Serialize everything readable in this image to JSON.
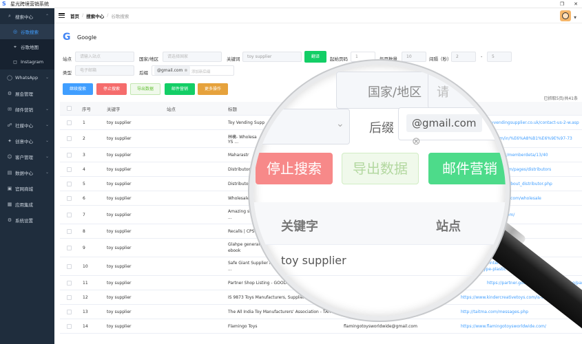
{
  "app": {
    "title": "星光跨境营销系统",
    "logo_glyph": "S"
  },
  "window": {
    "restore_glyph": "❐",
    "close_glyph": "✕"
  },
  "sidebar": {
    "items": [
      {
        "label": "搜索中心",
        "icon": "search-icon",
        "glyph": "⌕",
        "arrow": "⌃"
      },
      {
        "label": "谷歌搜索",
        "icon": "google-search-icon",
        "glyph": "◎",
        "sub": true,
        "active": true
      },
      {
        "label": "谷歌地图",
        "icon": "map-pin-icon",
        "glyph": "⌖",
        "sub": true
      },
      {
        "label": "Instagram",
        "icon": "instagram-icon",
        "glyph": "◻",
        "sub": true
      },
      {
        "label": "WhatsApp",
        "icon": "whatsapp-icon",
        "glyph": "◯",
        "arrow": "⌄"
      },
      {
        "label": "展会管理",
        "icon": "expo-icon",
        "glyph": "⚙"
      },
      {
        "label": "邮件营销",
        "icon": "mail-icon",
        "glyph": "✉",
        "arrow": "⌄"
      },
      {
        "label": "社媒中心",
        "icon": "social-icon",
        "glyph": "☍",
        "arrow": "⌄"
      },
      {
        "label": "创意中心",
        "icon": "idea-icon",
        "glyph": "✦",
        "arrow": "⌄"
      },
      {
        "label": "客户管理",
        "icon": "customer-icon",
        "glyph": "☺",
        "arrow": "⌄"
      },
      {
        "label": "数据中心",
        "icon": "data-icon",
        "glyph": "▤",
        "arrow": "⌄"
      },
      {
        "label": "官网商城",
        "icon": "store-icon",
        "glyph": "▣"
      },
      {
        "label": "应用集成",
        "icon": "apps-icon",
        "glyph": "▦"
      },
      {
        "label": "系统设置",
        "icon": "settings-icon",
        "glyph": "⚙"
      }
    ]
  },
  "breadcrumb": {
    "home": "首页",
    "sep": "/",
    "section": "搜索中心",
    "current": "谷歌搜索"
  },
  "page": {
    "engine_name": "Google",
    "stats": "已抓取5页/共41条"
  },
  "filters": {
    "site_label": "站点",
    "site_placeholder": "请输入站点",
    "country_label": "国家/地区",
    "country_placeholder": "请选择国家",
    "keyword_label": "关键词",
    "keyword_value": "toy supplier",
    "translate_label": "翻译",
    "start_page_label": "起始页码",
    "start_page_value": "1",
    "per_page_label": "每页数量",
    "per_page_value": "10",
    "interval_label": "间隔（秒）",
    "interval_from": "2",
    "interval_dash": "-",
    "interval_to": "5",
    "type_label": "类型",
    "type_value": "电子邮箱",
    "suffix_label": "后缀",
    "suffix_tag": "@gmail.com",
    "suffix_placeholder": "添加新后缀"
  },
  "actions": {
    "continue": "继续搜索",
    "stop": "停止搜索",
    "export": "导出数据",
    "email": "邮件营销",
    "more": "更多操作"
  },
  "table": {
    "headers": [
      "序号",
      "关键字",
      "站点",
      "标题"
    ],
    "rows": [
      {
        "no": "1",
        "kw": "toy supplier",
        "title": "Toy Vending Supp",
        "email": "",
        "url": "toyvendingsupplier.co.uk/contact-us-2-w.asp"
      },
      {
        "no": "2",
        "kw": "toy supplier",
        "title": "林檎- Wholesa",
        "title2": "YS ...",
        "email": "",
        "url": "din.com/in/%E6%A8%B1%E6%9E%97-73"
      },
      {
        "no": "3",
        "kw": "toy supplier",
        "title": "Maharastr",
        "email": "",
        "url": "members/memberdeta/13/40"
      },
      {
        "no": "4",
        "kw": "toy supplier",
        "title": "Distributor",
        "email": "",
        "url": "eaftoys.com/pages/distributors"
      },
      {
        "no": "5",
        "kw": "toy supplier",
        "title": "Distributor",
        "email": "",
        "url": "com/html/about_distributor.php"
      },
      {
        "no": "6",
        "kw": "toy supplier",
        "title": "Wholesale",
        "email": "",
        "url": "ockerstoys.com/wholesale"
      },
      {
        "no": "7",
        "kw": "toy supplier",
        "title": "Amazing scie",
        "title2": "...",
        "email": "",
        "url": "ncetoys.com/"
      },
      {
        "no": "8",
        "kw": "toy supplier",
        "title": "Recalls | CPSC.go",
        "email": "",
        "url": ""
      },
      {
        "no": "9",
        "kw": "toy supplier",
        "title": "Glahpe general supplie",
        "title2": "ebook",
        "email": "",
        "url": "08720500172527"
      },
      {
        "no": "10",
        "kw": "toy supplier",
        "title": "Safe Giant Supplier indoor playgro",
        "title2": "...",
        "email": "",
        "url": "https://www.pinterest.com/pin/safe-gi",
        "url2": "ayground-type-plastic-slides-for-brazil-"
      },
      {
        "no": "11",
        "kw": "toy supplier",
        "title": "Partner Shop Listing - GOOD SMILE COMPANY",
        "email": "",
        "url": "https://partner.goodsmile.info/support/eng/partnershop"
      },
      {
        "no": "12",
        "kw": "toy supplier",
        "title": "IS 9873 Toys Manufacturers, Suppliers Ghaziabad, India",
        "email": "kindercreative@gmail.com",
        "url": "https://www.kindercreativetoys.com/is-toys.html"
      },
      {
        "no": "13",
        "kw": "toy supplier",
        "title": "The All India Toy Manufacturers' Association - TAITMA",
        "email": "technosoft@gmail.com",
        "url": "http://taitma.com/messages.php"
      },
      {
        "no": "14",
        "kw": "toy supplier",
        "title": "Flamingo Toys",
        "email": "flamingotoysworldwide@gmail.com",
        "url": "https://www.flamingotoysworldwide.com/"
      }
    ]
  },
  "magnifier": {
    "country_label": "国家/地区",
    "country_hint": "请",
    "suffix_label": "后缀",
    "suffix_value": "@gmail.com",
    "stop": "停止搜索",
    "export": "导出数据",
    "email": "邮件营销",
    "col_keyword": "关键字",
    "col_site": "站点",
    "row_value": "toy supplier"
  },
  "colors": {
    "sidebar_bg": "#1f2d3d",
    "primary": "#409eff",
    "danger": "#f56c6c",
    "success": "#13ce66",
    "warning": "#e6a23c"
  }
}
